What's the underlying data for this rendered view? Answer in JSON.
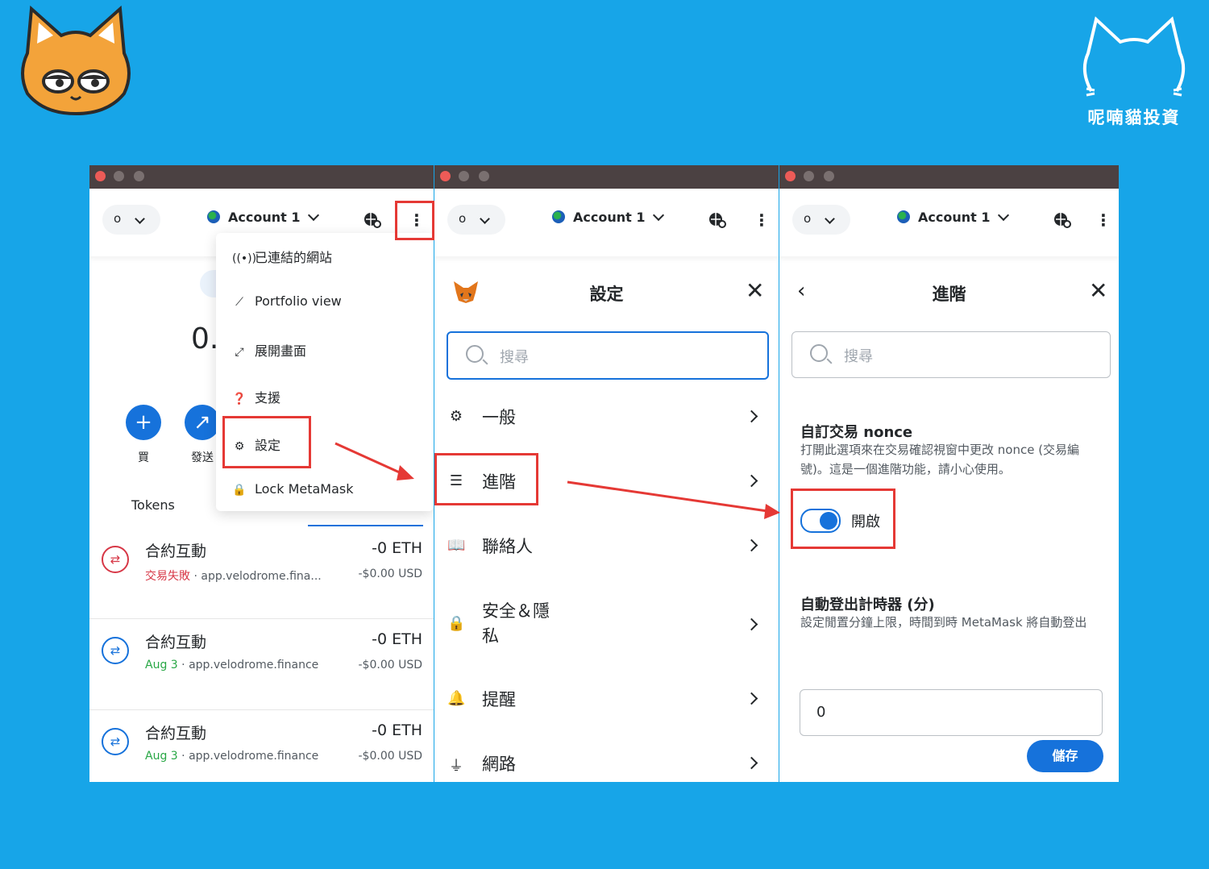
{
  "branding": {
    "text": "呢喃貓投資",
    "cat_icon": "cat-face-icon",
    "brand_icon": "cat-outline-icon"
  },
  "panel1": {
    "network_label": "o",
    "account": "Account 1",
    "balance_partial": "0.",
    "actions": [
      {
        "icon": "plus-icon",
        "label": "買"
      },
      {
        "icon": "send-arrow-icon",
        "label": "發送"
      }
    ],
    "tab_tokens": "Tokens",
    "menu": [
      {
        "icon": "broadcast-icon",
        "label": "已連結的網站"
      },
      {
        "icon": "chart-icon",
        "label": "Portfolio view"
      },
      {
        "icon": "expand-icon",
        "label": "展開畫面"
      },
      {
        "icon": "support-icon",
        "label": "支援"
      },
      {
        "icon": "gear-icon",
        "label": "設定"
      },
      {
        "icon": "lock-icon",
        "label": "Lock MetaMask"
      }
    ],
    "transactions": [
      {
        "title": "合約互動",
        "status": "交易失敗",
        "status_type": "failed",
        "source": "app.velodrome.fina...",
        "amount": "-0 ETH",
        "usd": "-$0.00 USD"
      },
      {
        "title": "合約互動",
        "status": "Aug 3",
        "status_type": "ok",
        "source": "app.velodrome.finance",
        "amount": "-0 ETH",
        "usd": "-$0.00 USD"
      },
      {
        "title": "合約互動",
        "status": "Aug 3",
        "status_type": "ok",
        "source": "app.velodrome.finance",
        "amount": "-0 ETH",
        "usd": "-$0.00 USD"
      }
    ]
  },
  "panel2": {
    "network_label": "o",
    "account": "Account 1",
    "title": "設定",
    "search_placeholder": "搜尋",
    "items": [
      {
        "icon": "gear-icon",
        "label": "一般"
      },
      {
        "icon": "sliders-icon",
        "label": "進階"
      },
      {
        "icon": "book-icon",
        "label": "聯絡人"
      },
      {
        "icon": "lock-icon",
        "label": "安全＆隱私"
      },
      {
        "icon": "bell-icon",
        "label": "提醒"
      },
      {
        "icon": "plug-icon",
        "label": "網路"
      }
    ]
  },
  "panel3": {
    "network_label": "o",
    "account": "Account 1",
    "title": "進階",
    "search_placeholder": "搜尋",
    "nonce_title": "自訂交易 nonce",
    "nonce_desc": "打開此選項來在交易確認視窗中更改 nonce (交易編號)。這是一個進階功能，請小心使用。",
    "nonce_toggle": {
      "on": true,
      "label": "開啟"
    },
    "autolock_title": "自動登出計時器 (分)",
    "autolock_desc": "設定閒置分鐘上限，時間到時 MetaMask 將自動登出",
    "autolock_value": "0",
    "save": "儲存"
  },
  "colors": {
    "background": "#17a5e8",
    "accent": "#1672db",
    "highlight": "#e53935",
    "failed": "#d73847",
    "ok": "#28a745"
  }
}
